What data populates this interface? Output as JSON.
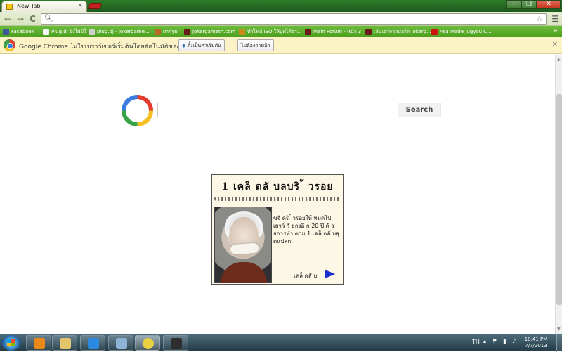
{
  "browser": {
    "tab": {
      "title": "New Tab"
    },
    "window_controls": {
      "minimize": "–",
      "maximize": "❐",
      "close": "✕"
    },
    "toolbar": {
      "back": "←",
      "forward": "→",
      "reload": "C",
      "omnibox_value": "",
      "star": "☆",
      "menu": "☰"
    },
    "bookmarks": [
      {
        "label": "Facebook",
        "icon": "facebook-icon",
        "color": "#3b5998"
      },
      {
        "label": "Plug.dj ยังไม่มีใ",
        "icon": "folder-icon",
        "color": "#f4f4f4"
      },
      {
        "label": "plug.dj - Jokergame...",
        "icon": "headphones-icon",
        "color": "#d0d0d0"
      },
      {
        "label": "ฝากรูป",
        "icon": "image-icon",
        "color": "#b86a2a"
      },
      {
        "label": "jokergameth.com",
        "icon": "joker-icon",
        "color": "#6a1a1a"
      },
      {
        "label": "ทำไฟล์ ISO ให้บูทได้จา...",
        "icon": "globe-icon",
        "color": "#c88a1a"
      },
      {
        "label": "Main Forum - หน้า 3",
        "icon": "joker-icon",
        "color": "#6a1a1a"
      },
      {
        "label": "เล่นเอาจากบอร์ด Jokerq...",
        "icon": "joker-icon",
        "color": "#6a1a1a"
      },
      {
        "label": "Asa Made Jugyou C...",
        "icon": "youtube-icon",
        "color": "#cc1111"
      }
    ],
    "bookmarks_more": "»",
    "infobar": {
      "message": "Google Chrome ไม่ใช่เบราว์เซอร์เริ่มต้นโดยอัตโนมัติของคุณ",
      "set_default": "ตั้งเป็นค่าเริ่มต้น",
      "dont_ask": "ไม่ต้องถามอีก",
      "close": "✕"
    }
  },
  "page": {
    "search": {
      "value": "",
      "button": "Search"
    },
    "ad": {
      "headline": "1 เคล็ ดลั บลบริ ้ วรอย",
      "body": "ขจั ดริ ้ วรอยให้ หมดไป เยาว์ วั ยลงอี ก 20 ปี ด้ วยการทำ ตาม 1 เคล็ ดลั บสุ ดแปลก",
      "cta": "เคล็ ดลั บ"
    }
  },
  "taskbar": {
    "apps": [
      {
        "name": "media-player",
        "color": "#e8891a"
      },
      {
        "name": "file-explorer",
        "color": "#e2c46a"
      },
      {
        "name": "internet-explorer",
        "color": "#2b8ae0"
      },
      {
        "name": "app-window",
        "color": "#8fb3d6"
      },
      {
        "name": "chrome",
        "color": "#e8d040"
      },
      {
        "name": "game-app",
        "color": "#2e2e2e"
      }
    ],
    "language": "TH",
    "clock_time": "10:41 PM",
    "clock_date": "7/7/2013"
  }
}
